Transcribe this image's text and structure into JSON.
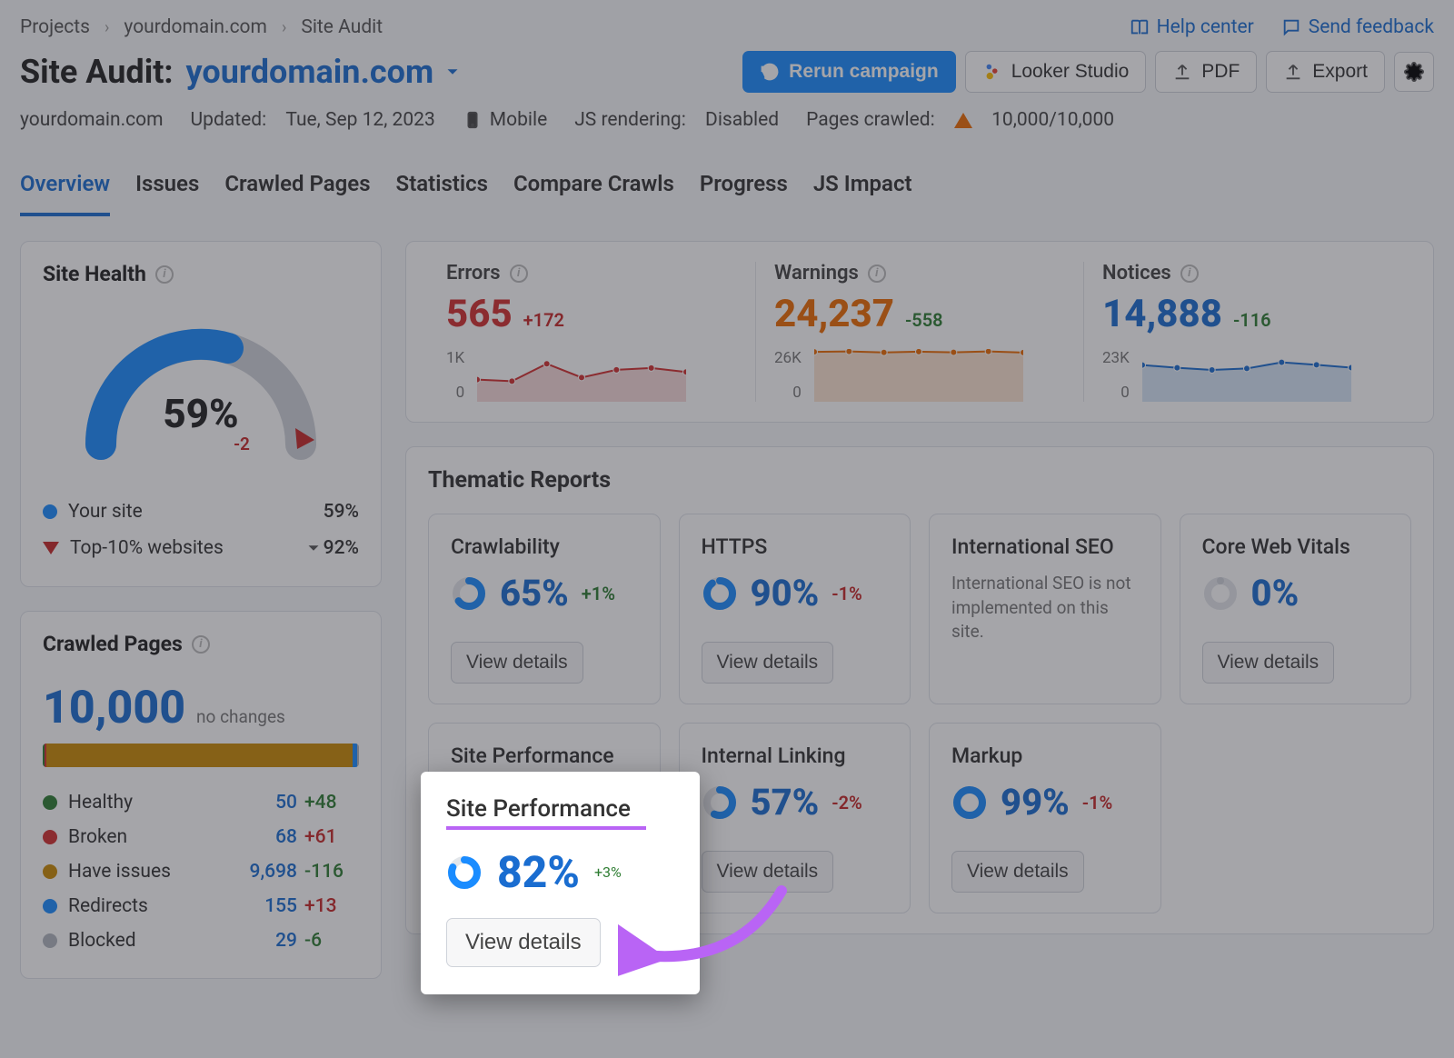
{
  "breadcrumbs": {
    "projects": "Projects",
    "domain": "yourdomain.com",
    "page": "Site Audit"
  },
  "topbar": {
    "help": "Help center",
    "feedback": "Send feedback"
  },
  "title": {
    "label": "Site Audit:",
    "domain": "yourdomain.com"
  },
  "actions": {
    "rerun": "Rerun campaign",
    "looker": "Looker Studio",
    "pdf": "PDF",
    "export": "Export"
  },
  "meta": {
    "domain": "yourdomain.com",
    "updated_label": "Updated:",
    "updated_value": "Tue, Sep 12, 2023",
    "device": "Mobile",
    "js_label": "JS rendering:",
    "js_value": "Disabled",
    "crawled_label": "Pages crawled:",
    "crawled_value": "10,000/10,000"
  },
  "tabs": [
    "Overview",
    "Issues",
    "Crawled Pages",
    "Statistics",
    "Compare Crawls",
    "Progress",
    "JS Impact"
  ],
  "site_health": {
    "title": "Site Health",
    "score": "59%",
    "delta": "-2",
    "your_site_label": "Your site",
    "your_site_val": "59%",
    "top10_label": "Top-10% websites",
    "top10_val": "92%"
  },
  "crawled": {
    "title": "Crawled Pages",
    "big": "10,000",
    "sub": "no changes",
    "rows": [
      {
        "label": "Healthy",
        "color": "#2e7d32",
        "num": "50",
        "delta": "+48",
        "dc": "pos"
      },
      {
        "label": "Broken",
        "color": "#d32f2f",
        "num": "68",
        "delta": "+61",
        "dc": "neg"
      },
      {
        "label": "Have issues",
        "color": "#ca8a04",
        "num": "9,698",
        "delta": "-116",
        "dc": "pos"
      },
      {
        "label": "Redirects",
        "color": "#1a8cff",
        "num": "155",
        "delta": "+13",
        "dc": "neg"
      },
      {
        "label": "Blocked",
        "color": "#b0b6be",
        "num": "29",
        "delta": "-6",
        "dc": "pos"
      }
    ]
  },
  "summary": [
    {
      "label": "Errors",
      "cls": "errors-c",
      "value": "565",
      "delta": "+172",
      "dc": "neg",
      "ytop": "1K",
      "ybot": "0"
    },
    {
      "label": "Warnings",
      "cls": "warnings-c",
      "value": "24,237",
      "delta": "-558",
      "dc": "pos",
      "ytop": "26K",
      "ybot": "0"
    },
    {
      "label": "Notices",
      "cls": "notices-c",
      "value": "14,888",
      "delta": "-116",
      "dc": "pos",
      "ytop": "23K",
      "ybot": "0"
    }
  ],
  "thematic": {
    "title": "Thematic Reports",
    "cards": [
      {
        "title": "Crawlability",
        "pct": "65%",
        "delta": "+1%",
        "dc": "pos",
        "vd": "View details"
      },
      {
        "title": "HTTPS",
        "pct": "90%",
        "delta": "-1%",
        "dc": "neg",
        "vd": "View details"
      },
      {
        "title": "International SEO",
        "note": "International SEO is not implemented on this site."
      },
      {
        "title": "Core Web Vitals",
        "pct": "0%",
        "grey": true,
        "vd": "View details"
      },
      {
        "title": "Site Performance",
        "pct": "82%",
        "delta": "+3%",
        "dc": "pos",
        "vd": "View details",
        "highlight": true
      },
      {
        "title": "Internal Linking",
        "pct": "57%",
        "delta": "-2%",
        "dc": "neg",
        "vd": "View details"
      },
      {
        "title": "Markup",
        "pct": "99%",
        "delta": "-1%",
        "dc": "neg",
        "vd": "View details"
      }
    ]
  },
  "chart_data": {
    "site_health_gauge": {
      "type": "gauge",
      "value": 59,
      "delta": -2,
      "top10": 92,
      "range": [
        0,
        100
      ]
    },
    "crawled_pages_bar": {
      "type": "stacked_bar",
      "total": 10000,
      "segments": [
        {
          "label": "Healthy",
          "value": 50,
          "color": "#2e7d32"
        },
        {
          "label": "Broken",
          "value": 68,
          "color": "#d32f2f"
        },
        {
          "label": "Have issues",
          "value": 9698,
          "color": "#ca8a04"
        },
        {
          "label": "Redirects",
          "value": 155,
          "color": "#1a8cff"
        },
        {
          "label": "Blocked",
          "value": 29,
          "color": "#b0b6be"
        }
      ]
    },
    "summary_sparks": [
      {
        "name": "Errors",
        "type": "area",
        "ylim": [
          0,
          1000
        ],
        "values": [
          420,
          390,
          720,
          460,
          605,
          640,
          565
        ],
        "color": "#d32f2f"
      },
      {
        "name": "Warnings",
        "type": "area",
        "ylim": [
          0,
          26000
        ],
        "values": [
          24600,
          24800,
          24300,
          24700,
          24400,
          24800,
          24237
        ],
        "color": "#ed6c02"
      },
      {
        "name": "Notices",
        "type": "area",
        "ylim": [
          0,
          23000
        ],
        "values": [
          16000,
          14800,
          13900,
          14500,
          17200,
          16100,
          14888
        ],
        "color": "#1a6dd0"
      }
    ],
    "thematic_scores": {
      "Crawlability": 65,
      "HTTPS": 90,
      "Core Web Vitals": 0,
      "Site Performance": 82,
      "Internal Linking": 57,
      "Markup": 99
    }
  }
}
